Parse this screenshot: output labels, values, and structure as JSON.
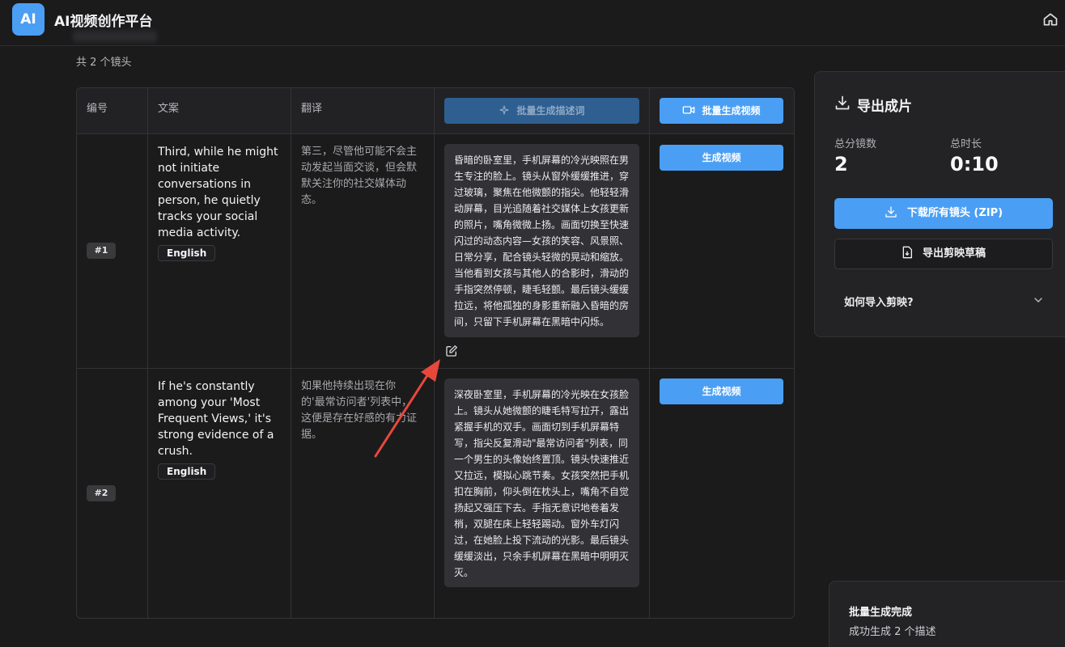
{
  "app": {
    "logo": "AI",
    "title": "AI视频创作平台",
    "home_icon": "home-icon"
  },
  "summary": {
    "shot_count": "共 2 个镜头"
  },
  "table": {
    "headers": {
      "id": "编号",
      "copy": "文案",
      "translation": "翻译"
    },
    "batch_desc_label": "批量生成描述词",
    "batch_video_label": "批量生成视频",
    "rows": [
      {
        "badge": "#1",
        "copy": "Third, while he might not initiate conversations in person, he quietly tracks your social media activity.",
        "lang": "English",
        "translation": "第三，尽管他可能不会主动发起当面交谈，但会默默关注你的社交媒体动态。",
        "description": "昏暗的卧室里，手机屏幕的冷光映照在男生专注的脸上。镜头从窗外缓缓推进，穿过玻璃，聚焦在他微颤的指尖。他轻轻滑动屏幕，目光追随着社交媒体上女孩更新的照片，嘴角微微上扬。画面切换至快速闪过的动态内容—女孩的笑容、风景照、日常分享，配合镜头轻微的晃动和缩放。当他看到女孩与其他人的合影时，滑动的手指突然停顿，睫毛轻颤。最后镜头缓缓拉远，将他孤独的身影重新融入昏暗的房间，只留下手机屏幕在黑暗中闪烁。",
        "gen_label": "生成视频"
      },
      {
        "badge": "#2",
        "copy": "If he's constantly among your 'Most Frequent Views,' it's strong evidence of a crush.",
        "lang": "English",
        "translation": "如果他持续出现在你的'最常访问者'列表中，这便是存在好感的有力证据。",
        "description": "深夜卧室里，手机屏幕的冷光映在女孩脸上。镜头从她微颤的睫毛特写拉开，露出紧握手机的双手。画面切到手机屏幕特写，指尖反复滑动\"最常访问者\"列表，同一个男生的头像始终置顶。镜头快速推近又拉远，模拟心跳节奏。女孩突然把手机扣在胸前，仰头倒在枕头上，嘴角不自觉扬起又强压下去。手指无意识地卷着发梢，双腿在床上轻轻踢动。窗外车灯闪过，在她脸上投下流动的光影。最后镜头缓缓淡出，只余手机屏幕在黑暗中明明灭灭。",
        "gen_label": "生成视频"
      }
    ]
  },
  "export": {
    "title": "导出成片",
    "stats": [
      {
        "label": "总分镜数",
        "value": "2"
      },
      {
        "label": "总时长",
        "value": "0:10"
      }
    ],
    "download_zip": "下载所有镜头 (ZIP)",
    "export_draft": "导出剪映草稿",
    "howto": "如何导入剪映?"
  },
  "toast": {
    "title": "批量生成完成",
    "message": "成功生成 2 个描述"
  },
  "colors": {
    "accent": "#4a9ff5",
    "annotation_arrow": "#e8483c"
  }
}
